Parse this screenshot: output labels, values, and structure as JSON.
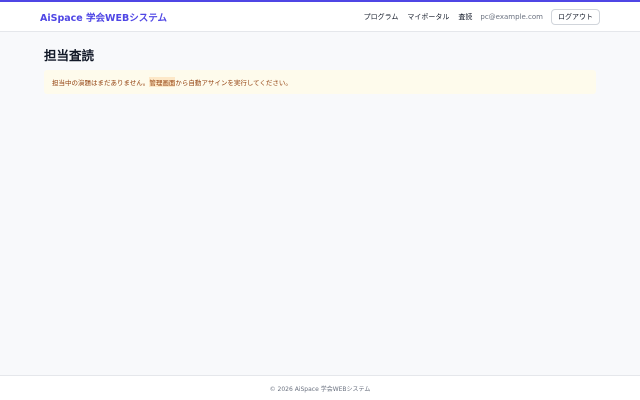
{
  "header": {
    "brand": "AiSpace 学会WEBシステム",
    "nav": {
      "program": "プログラム",
      "myportal": "マイポータル",
      "review": "査読",
      "email": "pc@example.com",
      "logout": "ログアウト"
    }
  },
  "main": {
    "title": "担当査読",
    "notice": {
      "pre": "担当中の演題はまだありません。",
      "link": "管理画面",
      "post": "から自動アサインを実行してください。"
    }
  },
  "footer": {
    "text": "© 2026 AiSpace 学会WEBシステム"
  },
  "colors": {
    "accent": "#4f46e5",
    "notice_bg": "#fefbec",
    "notice_text": "#92400e",
    "page_bg": "#f8f9fb"
  }
}
